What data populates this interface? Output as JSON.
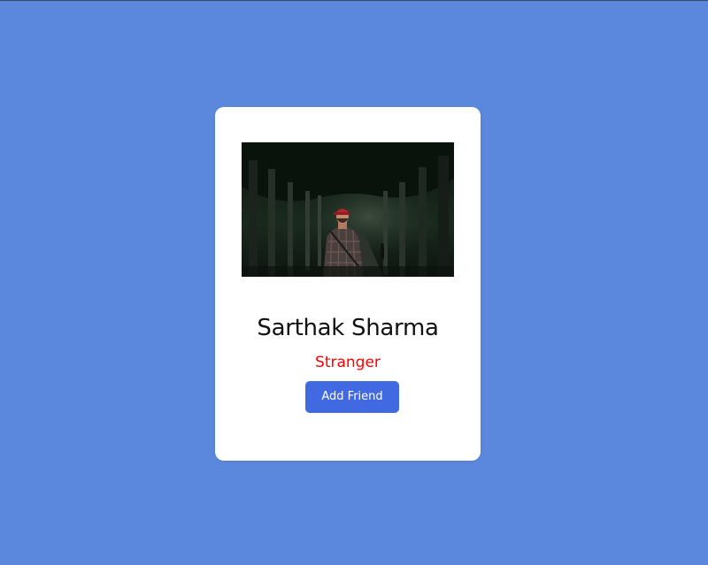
{
  "profile": {
    "name": "Sarthak Sharma",
    "status": "Stranger",
    "add_friend_label": "Add Friend"
  },
  "colors": {
    "background": "#5b87dd",
    "card": "#ffffff",
    "status": "#ff0000",
    "button": "#4169e1"
  }
}
